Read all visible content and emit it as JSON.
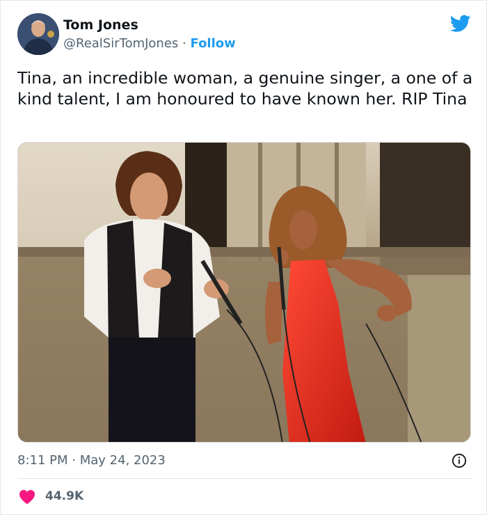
{
  "author": {
    "name": "Tom Jones",
    "handle": "@RealSirTomJones",
    "separator": "·",
    "follow_label": "Follow"
  },
  "tweet": {
    "text": "Tina, an incredible woman, a genuine singer, a one of a kind talent, I am honoured to have known her. RIP Tina",
    "time": "8:11 PM",
    "separator": "·",
    "date": "May 24, 2023"
  },
  "engagement": {
    "likes": "44.9K"
  },
  "icons": {
    "brand": "twitter-bird-icon",
    "info": "info-icon",
    "like": "heart-icon"
  },
  "colors": {
    "brand": "#1d9bf0",
    "like": "#f91880",
    "muted": "#536471",
    "text": "#0f1419"
  }
}
